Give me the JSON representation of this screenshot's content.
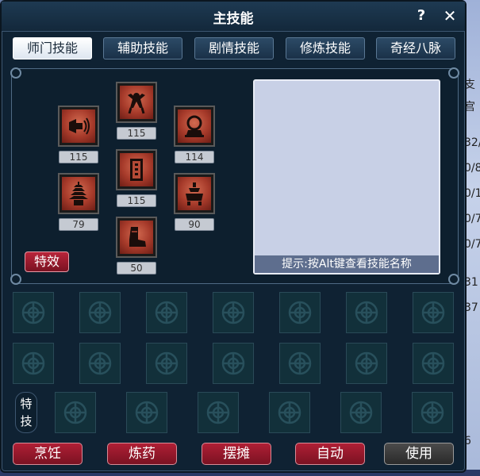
{
  "window": {
    "title": "主技能",
    "help_label": "?",
    "close_label": "✕"
  },
  "tabs": [
    {
      "label": "师门技能",
      "active": true
    },
    {
      "label": "辅助技能",
      "active": false
    },
    {
      "label": "剧情技能",
      "active": false
    },
    {
      "label": "修炼技能",
      "active": false
    },
    {
      "label": "奇经八脉",
      "active": false
    }
  ],
  "skills": [
    {
      "icon": "horn-speaker-icon",
      "level": "115"
    },
    {
      "icon": "demon-figure-icon",
      "level": "115"
    },
    {
      "icon": "bell-altar-icon",
      "level": "114"
    },
    {
      "icon": "scroll-talisman-icon",
      "level": "115"
    },
    {
      "icon": "pagoda-icon",
      "level": "79"
    },
    {
      "icon": "incense-burner-icon",
      "level": "90"
    },
    {
      "icon": "boot-icon",
      "level": "50"
    }
  ],
  "effect_button": "特效",
  "description": {
    "hint": "提示:按Alt键查看技能名称"
  },
  "special_label": "特技",
  "bottom_buttons": [
    {
      "label": "烹饪",
      "style": "red"
    },
    {
      "label": "炼药",
      "style": "red"
    },
    {
      "label": "摆摊",
      "style": "red"
    },
    {
      "label": "自动",
      "style": "red"
    },
    {
      "label": "使用",
      "style": "dark"
    }
  ],
  "background_fragments": [
    "支",
    "宫",
    "32/",
    "0/8",
    "0/1",
    "0/7",
    "0/7",
    "31",
    "37",
    "",
    "",
    "6"
  ],
  "colors": {
    "panel_bg": "#0f2233",
    "skill_red": "#a63a2a",
    "button_red": "#b01f35",
    "slot_teal": "#12303a"
  }
}
